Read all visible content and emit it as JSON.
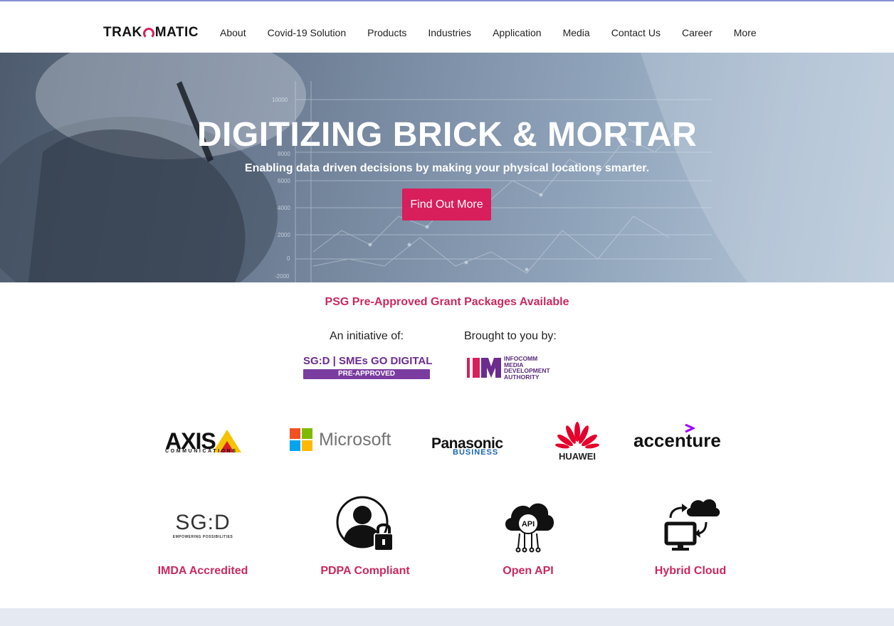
{
  "header": {
    "logo_left": "TRAK",
    "logo_right": "MATIC",
    "nav": [
      "About",
      "Covid-19 Solution",
      "Products",
      "Industries",
      "Application",
      "Media",
      "Contact Us",
      "Career",
      "More"
    ]
  },
  "hero": {
    "title": "DIGITIZING BRICK & MORTAR",
    "subtitle": "Enabling data driven decisions by making your physical locations smarter.",
    "cta": "Find Out More",
    "chart_ticks": [
      "10000",
      "8000",
      "6000",
      "4000",
      "2000",
      "0",
      "-2000"
    ]
  },
  "grant": {
    "headline": "PSG Pre-Approved Grant Packages Available",
    "initiative_label": "An initiative of:",
    "brought_label": "Brought to you by:",
    "sgd_badge_main": "SG:D | SMEs GO DIGITAL",
    "sgd_badge_sub": "PRE-APPROVED",
    "imda_text": "INFOCOMM\nMEDIA\nDEVELOPMENT\nAUTHORITY"
  },
  "partners": {
    "axis": "AXIS",
    "axis_sub": "COMMUNICATIONS",
    "microsoft": "Microsoft",
    "panasonic": "Panasonic",
    "panasonic_sub": "BUSINESS",
    "huawei": "HUAWEI",
    "accenture": "accenture"
  },
  "features": [
    {
      "label": "IMDA Accredited",
      "icon": "sgd-logo",
      "logo_text": "SG:D",
      "logo_sub": "EMPOWERING POSSIBILITIES"
    },
    {
      "label": "PDPA Compliant",
      "icon": "user-lock-icon"
    },
    {
      "label": "Open API",
      "icon": "api-cloud-icon",
      "icon_text": "API"
    },
    {
      "label": "Hybrid Cloud",
      "icon": "hybrid-cloud-icon"
    }
  ],
  "colors": {
    "accent": "#d81e5b",
    "heading_pink": "#c9295e",
    "sgd_purple": "#6b2c8e"
  }
}
